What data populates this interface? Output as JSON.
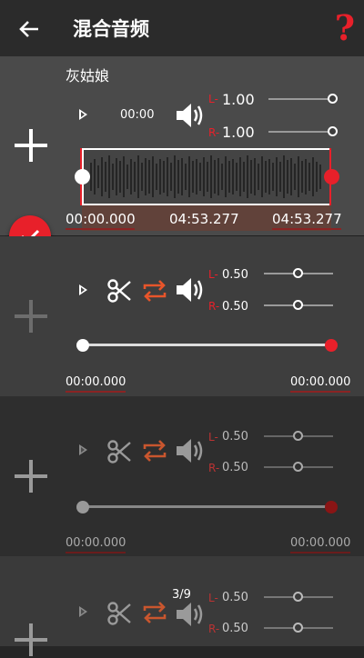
{
  "header": {
    "title": "混合音频",
    "help": "?"
  },
  "tracks": [
    {
      "name": "灰姑娘",
      "play_time": "00:00",
      "left_label": "L-",
      "left_value": "1.00",
      "right_label": "R-",
      "right_value": "1.00",
      "start": "00:00.000",
      "duration": "04:53.277",
      "end": "04:53.277"
    },
    {
      "left_label": "L-",
      "left_value": "0.50",
      "right_label": "R-",
      "right_value": "0.50",
      "start": "00:00.000",
      "end": "00:00.000"
    },
    {
      "left_label": "L-",
      "left_value": "0.50",
      "right_label": "R-",
      "right_value": "0.50",
      "start": "00:00.000",
      "end": "00:00.000"
    },
    {
      "counter": "3/9",
      "left_label": "L-",
      "left_value": "0.50",
      "right_label": "R-",
      "right_value": "0.50"
    }
  ],
  "colors": {
    "accent": "#e8202a",
    "loop": "#e8552a"
  },
  "icons": [
    "back-arrow-icon",
    "help-icon",
    "add-icon",
    "play-icon",
    "scissors-icon",
    "loop-icon",
    "volume-icon",
    "check-icon"
  ]
}
